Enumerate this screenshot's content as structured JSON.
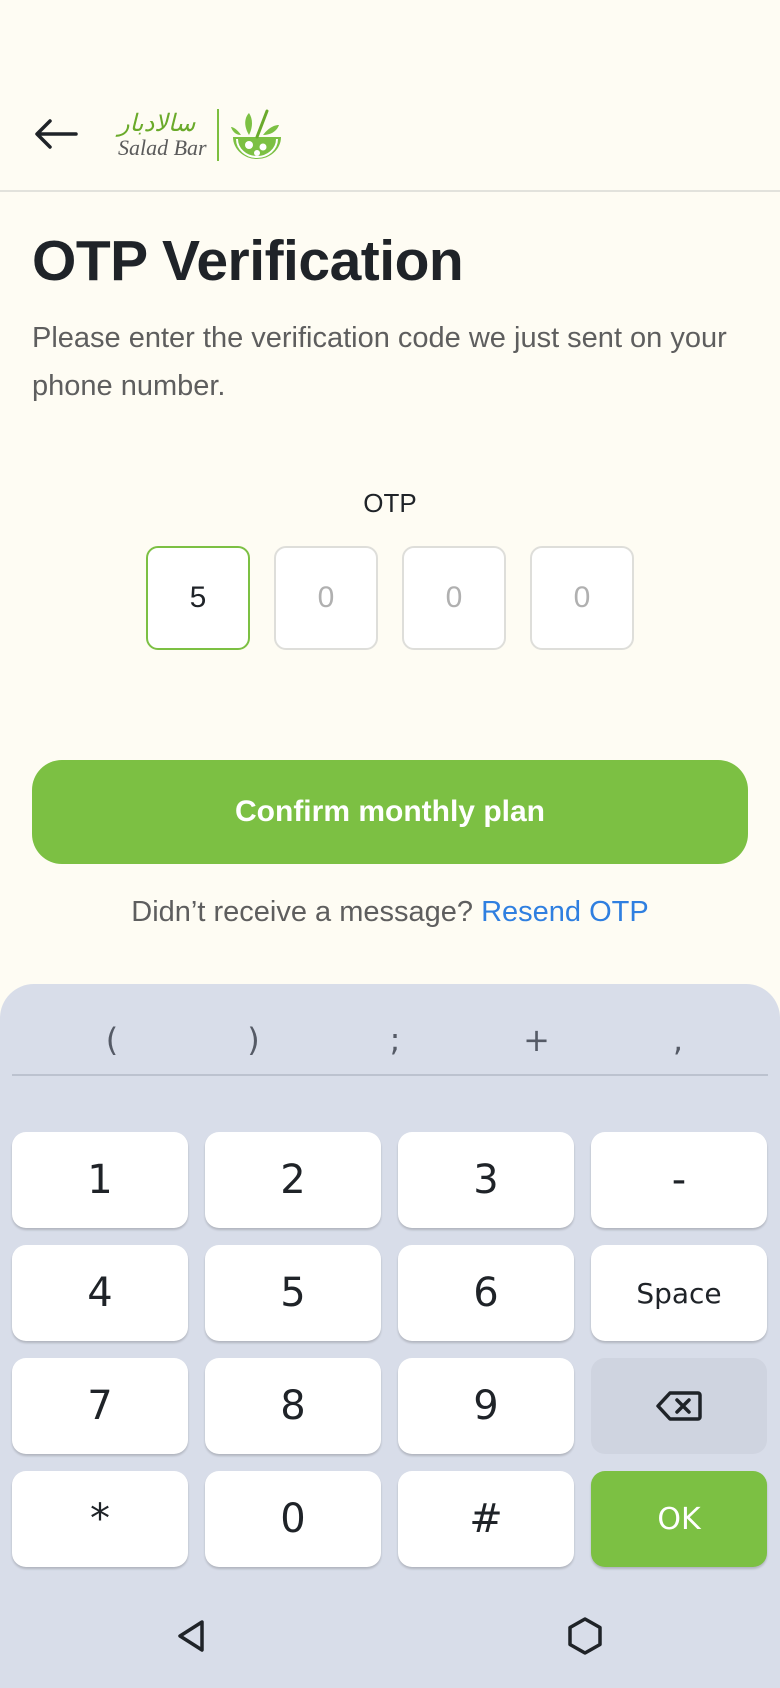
{
  "header": {
    "back_icon": "arrow-left-icon",
    "logo_arabic": "سالادبار",
    "logo_english": "Salad Bar",
    "logo_icon": "salad-bowl-icon"
  },
  "main": {
    "title": "OTP Verification",
    "subtitle": "Please enter the verification code we just sent on your phone number.",
    "otp_label": "OTP",
    "otp_digits": [
      {
        "value": "5",
        "placeholder": "0"
      },
      {
        "value": "",
        "placeholder": "0"
      },
      {
        "value": "",
        "placeholder": "0"
      },
      {
        "value": "",
        "placeholder": "0"
      }
    ],
    "confirm_label": "Confirm monthly plan",
    "resend_prompt": "Didn’t receive a message?",
    "resend_link": "Resend OTP"
  },
  "keyboard": {
    "symbols": [
      "(",
      ")",
      ";",
      "+",
      ","
    ],
    "keys": [
      "1",
      "2",
      "3",
      "-",
      "4",
      "5",
      "6",
      "Space",
      "7",
      "8",
      "9",
      "",
      "*",
      "0",
      "#",
      "OK"
    ],
    "backspace_icon": "backspace-icon"
  },
  "navbar": {
    "back_icon": "nav-back-triangle-icon",
    "home_icon": "nav-home-hexagon-icon"
  },
  "colors": {
    "accent": "#7cc043",
    "link": "#2f7fe0",
    "background": "#fefcf3",
    "keyboard_bg": "#d8dde9"
  }
}
